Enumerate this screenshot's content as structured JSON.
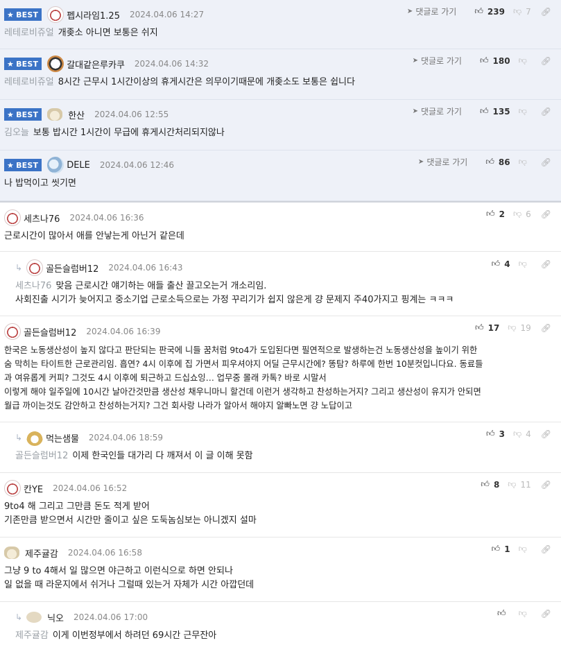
{
  "labels": {
    "best": "BEST",
    "reply_to": "댓글로 가기"
  },
  "comments": [
    {
      "nick": "펩시라임1.25",
      "date": "2024.04.06 14:27",
      "mention": "레테로비쥬얼",
      "body": "개좆소 아니면 보통은 쉬지",
      "up": "239",
      "down": "7"
    },
    {
      "nick": "갈대같은루카쿠",
      "date": "2024.04.06 14:32",
      "mention": "레테로비쥬얼",
      "body": "8시간 근무시 1시간이상의 휴게시간은 의무이기때문에 개좆소도 보통은 쉽니다",
      "up": "180",
      "down": ""
    },
    {
      "nick": "한산",
      "date": "2024.04.06 12:55",
      "mention": "김오늘",
      "body": "보통 밥시간 1시간이 무급에 휴게시간처리되지않나",
      "up": "135",
      "down": ""
    },
    {
      "nick": "DELE",
      "date": "2024.04.06 12:46",
      "mention": "",
      "body": "나 밥먹이고 씻기면",
      "up": "86",
      "down": ""
    },
    {
      "nick": "세츠나76",
      "date": "2024.04.06 16:36",
      "mention": "",
      "body": "근로시간이 많아서 애를 안낳는게 아닌거 같은데",
      "up": "2",
      "down": "6"
    },
    {
      "nick": "골든슬럼버12",
      "date": "2024.04.06 16:43",
      "mention": "세츠나76",
      "body": "맞음 근로시간 얘기하는 애들 출산 끌고오는거 개소리임.",
      "body2": "사회진출 시기가 늦어지고 중소기업 근로소득으로는 가정 꾸리기가 쉽지 않은게 걍 문제지 주40가지고 핑계는 ㅋㅋㅋ",
      "up": "4",
      "down": ""
    },
    {
      "nick": "골든슬럼버12",
      "date": "2024.04.06 16:39",
      "mention": "",
      "lines": [
        "한국은 노동생산성이 높지 않다고 판단되는 판국에 니들 꿈처럼 9to4가 도입된다면 필연적으로 발생하는건 노동생산성을 높이기 위한",
        "숨 막히는 타이트한 근로관리임. 흡연? 4시 이후에 집 가면서 피우셔야지 어딜 근무시간에? 똥탐? 하루에 한번 10분컷입니다요. 동료들",
        "과 여유롭게 커피? 그것도 4시 이후에 퇴근하고 드십쇼잉… 업무중 몰래 카톡? 바로 시말서",
        "이렇게 해야 일주일에 10시간 날아간것만큼 생산성 채우니마니 할건데 이런거 생각하고 찬성하는거지? 그리고 생산성이 유지가 안되면",
        "월급 까이는것도 감안하고 찬성하는거지? 그건 회사랑 나라가 알아서 해야지 알빠노면 걍 노답이고"
      ],
      "up": "17",
      "down": "19"
    },
    {
      "nick": "먹는샘물",
      "date": "2024.04.06 18:59",
      "mention": "골든슬럼버12",
      "body": "이제 한국인들 대가리 다 깨져서 이 글 이해 못함",
      "up": "3",
      "down": "4"
    },
    {
      "nick": "칸YE",
      "date": "2024.04.06 16:52",
      "mention": "",
      "body": "9to4 해 그리고 그만큼 돈도 적게 받어",
      "body2": "기존만큼 받으면서 시간만 줄이고 싶은 도둑놈심보는 아니겠지 설마",
      "up": "8",
      "down": "11"
    },
    {
      "nick": "제주귤감",
      "date": "2024.04.06 16:58",
      "mention": "",
      "body": "그냥 9 to 4해서 일 많으면 야근하고 이런식으로 하면 안되나",
      "body2": "일 없을 때 라운지에서 쉬거나 그럴때 있는거 자체가 시간 아깝던데",
      "up": "1",
      "down": ""
    },
    {
      "nick": "닉오",
      "date": "2024.04.06 17:00",
      "mention": "제주귤감",
      "body": "이게 이번정부에서 하려던 69시간 근무잔아",
      "up": "",
      "down": ""
    }
  ]
}
